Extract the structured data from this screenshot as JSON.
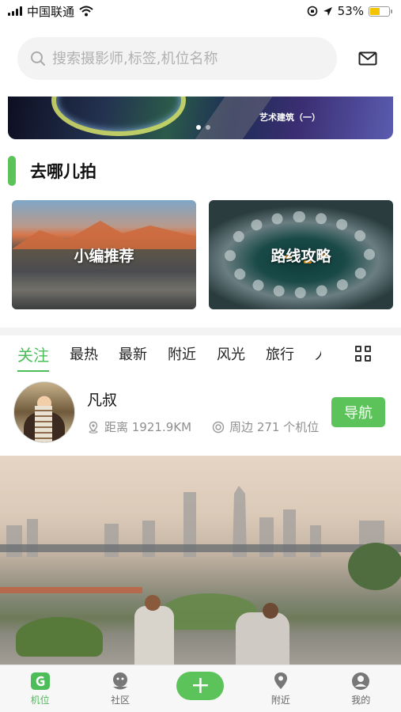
{
  "status_bar": {
    "carrier": "中国联通",
    "battery": "53%",
    "battery_level": 0.53
  },
  "search": {
    "placeholder": "搜索摄影师,标签,机位名称"
  },
  "banner": {
    "caption": "艺术建筑（一）"
  },
  "section": {
    "title": "去哪儿拍"
  },
  "cards": [
    {
      "label": "小编推荐"
    },
    {
      "label": "路线攻略"
    }
  ],
  "tabs": [
    "关注",
    "最热",
    "最新",
    "附近",
    "风光",
    "旅行",
    "人"
  ],
  "spot": {
    "name": "凡叔",
    "distance": "距离 1921.9KM",
    "nearby": "周边 271 个机位",
    "nav_button": "导航"
  },
  "bottom_nav": {
    "items": [
      "机位",
      "社区",
      "附近",
      "我的"
    ],
    "active": "机位"
  },
  "colors": {
    "accent": "#5cc35a",
    "tab_active": "#4cbd59"
  }
}
